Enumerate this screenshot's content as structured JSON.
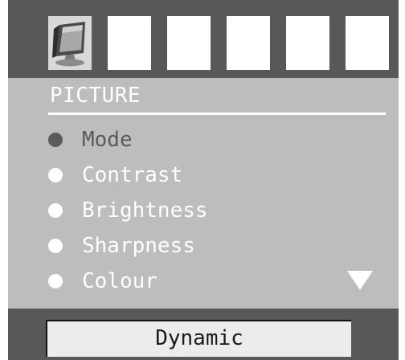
{
  "colors": {
    "frame": "#585858",
    "panel": "#bdbdbd",
    "text": "#ffffff",
    "selected": "#5b5b5b",
    "value_box": "#ececec"
  },
  "tabs": [
    {
      "icon": "monitor-icon",
      "active": true
    },
    {
      "icon": "blank"
    },
    {
      "icon": "blank"
    },
    {
      "icon": "blank"
    },
    {
      "icon": "blank"
    },
    {
      "icon": "blank"
    }
  ],
  "menu": {
    "title": "PICTURE",
    "items": [
      {
        "label": "Mode",
        "selected": true
      },
      {
        "label": "Contrast"
      },
      {
        "label": "Brightness"
      },
      {
        "label": "Sharpness"
      },
      {
        "label": "Colour"
      }
    ],
    "scroll_icon": "down-triangle-icon"
  },
  "value": {
    "current": "Dynamic"
  }
}
